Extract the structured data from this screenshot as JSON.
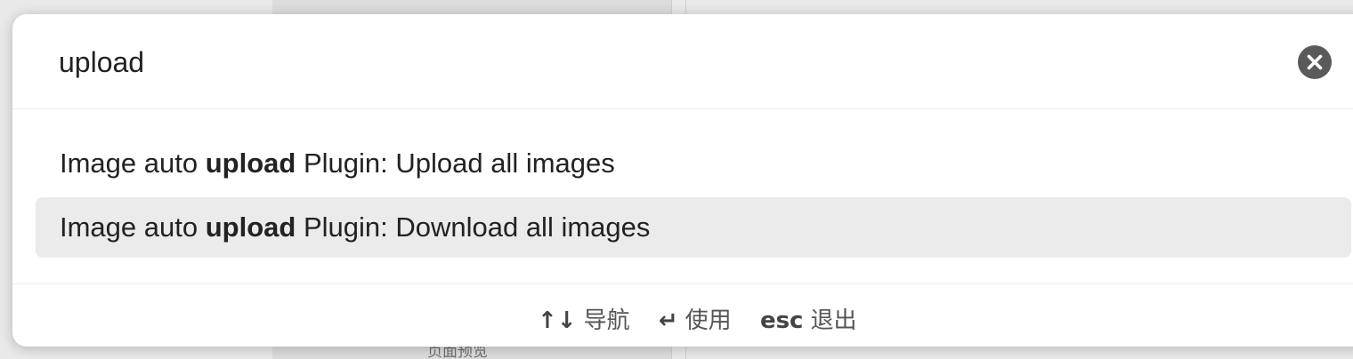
{
  "background": {
    "top_text": "...",
    "left_panel_text": "页面预览",
    "right_text": "..."
  },
  "search": {
    "value": "upload",
    "placeholder": ""
  },
  "results": [
    {
      "prefix": "Image auto ",
      "match": "upload",
      "suffix": " Plugin: Upload all images",
      "selected": false
    },
    {
      "prefix": "Image auto ",
      "match": "upload",
      "suffix": " Plugin: Download all images",
      "selected": true
    }
  ],
  "footer": {
    "navigate_key": "↑↓",
    "navigate_label": "导航",
    "use_key": "↵",
    "use_label": "使用",
    "exit_key": "esc",
    "exit_label": "退出"
  },
  "colors": {
    "selected_row": "#ebebeb",
    "clear_button": "#5a5a5a"
  }
}
